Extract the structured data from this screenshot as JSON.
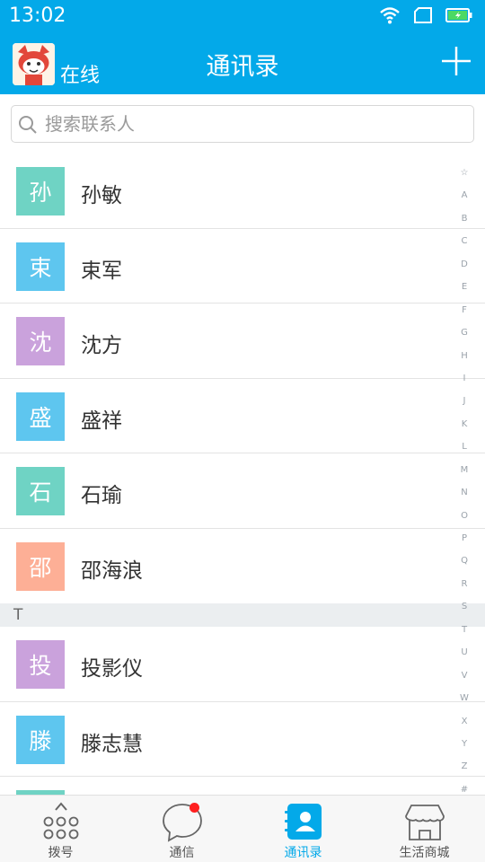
{
  "status_bar": {
    "time": "13:02"
  },
  "header": {
    "presence": "在线",
    "title": "通讯录"
  },
  "search": {
    "placeholder": "搜索联系人"
  },
  "contacts_top": [
    {
      "initial": "孙",
      "name": "孙敏",
      "color": "#6fd3c4"
    },
    {
      "initial": "束",
      "name": "束军",
      "color": "#5ec6ef"
    },
    {
      "initial": "沈",
      "name": "沈方",
      "color": "#caa2dc"
    },
    {
      "initial": "盛",
      "name": "盛祥",
      "color": "#5ec6ef"
    },
    {
      "initial": "石",
      "name": "石瑜",
      "color": "#6fd3c4"
    },
    {
      "initial": "邵",
      "name": "邵海浪",
      "color": "#fdaf96"
    }
  ],
  "section_t": {
    "letter": "T"
  },
  "contacts_t": [
    {
      "initial": "投",
      "name": "投影仪",
      "color": "#caa2dc"
    },
    {
      "initial": "滕",
      "name": "滕志慧",
      "color": "#5ec6ef"
    },
    {
      "initial": "",
      "name": "",
      "color": "#6fd3c4"
    }
  ],
  "index_bar": [
    "☆",
    "A",
    "B",
    "C",
    "D",
    "E",
    "F",
    "G",
    "H",
    "I",
    "J",
    "K",
    "L",
    "M",
    "N",
    "O",
    "P",
    "Q",
    "R",
    "S",
    "T",
    "U",
    "V",
    "W",
    "X",
    "Y",
    "Z",
    "#"
  ],
  "bottom_nav": [
    {
      "label": "拨号",
      "icon": "dialpad-icon"
    },
    {
      "label": "通信",
      "icon": "chat-bubble-icon"
    },
    {
      "label": "通讯录",
      "icon": "contacts-book-icon",
      "active": true
    },
    {
      "label": "生活商城",
      "icon": "shop-icon"
    }
  ],
  "colors": {
    "accent": "#03a9e9",
    "badge": "#ff1f1f"
  }
}
